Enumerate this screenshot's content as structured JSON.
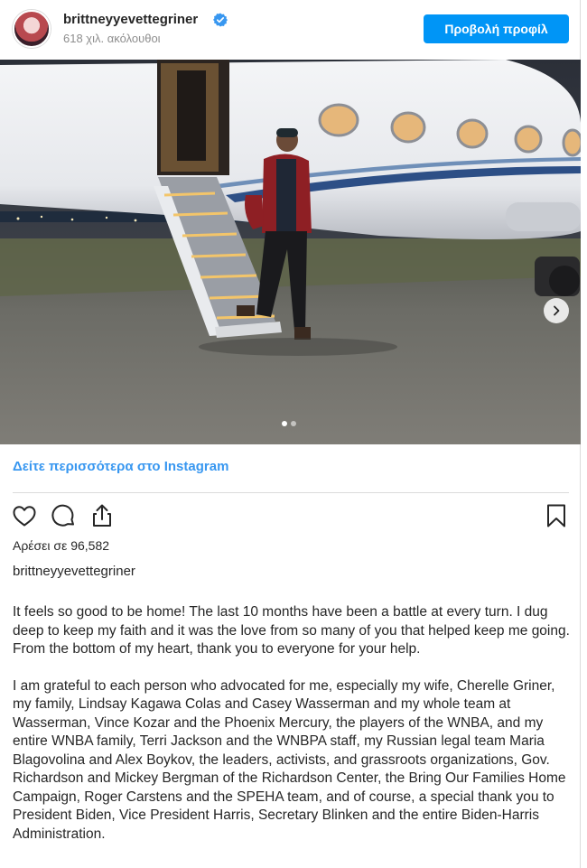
{
  "header": {
    "username": "brittneyyevettegriner",
    "followers": "618 χιλ. ακόλουθοι",
    "view_profile_label": "Προβολή προφίλ"
  },
  "post": {
    "see_more_link": "Δείτε περισσότερα στο Instagram",
    "likes": "Αρέσει σε 96,582",
    "caption_username": "brittneyyevettegriner",
    "caption_paragraphs": [
      "It feels so good to be home! The last 10 months have been a battle at every turn. I dug deep to keep my faith and it was the love from so many of you that helped keep me going. From the bottom of my heart, thank you to everyone for your help.",
      "I am grateful to each person who advocated for me, especially my wife, Cherelle Griner, my family, Lindsay Kagawa Colas and Casey Wasserman and my whole team at Wasserman, Vince Kozar and the Phoenix Mercury, the players of the WNBA, and my entire WNBA family, Terri Jackson and the WNBPA staff, my Russian legal team Maria Blagovolina and Alex Boykov, the leaders, activists, and grassroots organizations, Gov. Richardson and Mickey Bergman of the Richardson Center, the Bring Our Families Home Campaign, Roger Carstens and the SPEHA team, and of course, a special thank you to President Biden, Vice President Harris, Secretary Blinken and the entire Biden-Harris Administration."
    ],
    "carousel": {
      "total": 2,
      "current": 1
    }
  },
  "icons": {
    "verified": "verified-badge-icon",
    "like": "heart-icon",
    "comment": "comment-icon",
    "share": "share-icon",
    "save": "bookmark-icon",
    "next": "chevron-right-icon"
  },
  "colors": {
    "accent": "#0095f6",
    "link": "#3897f0",
    "text": "#262626",
    "muted": "#8e8e8e"
  }
}
